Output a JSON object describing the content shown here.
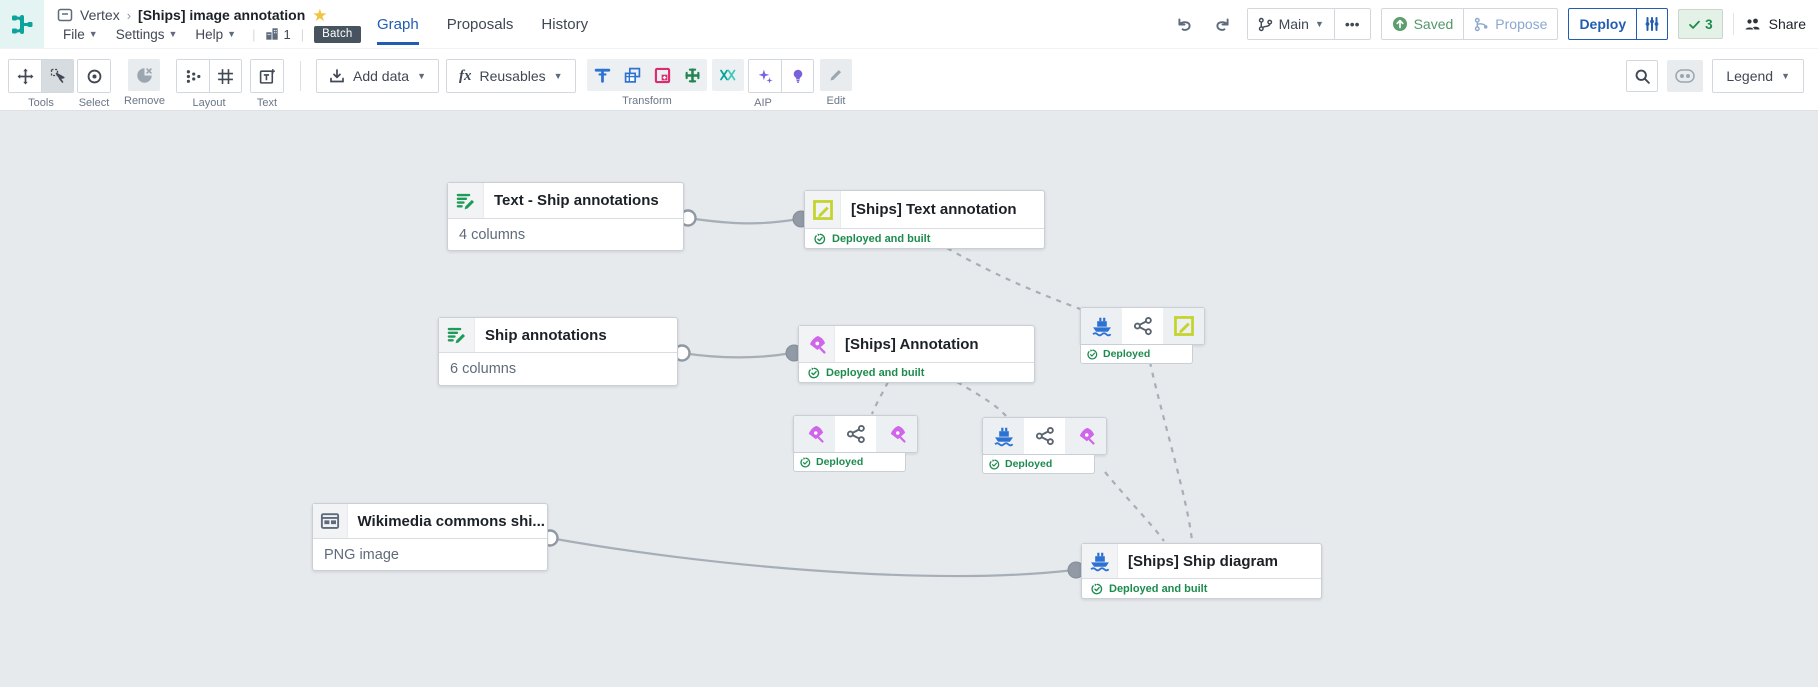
{
  "header": {
    "breadcrumb": {
      "app": "Vertex",
      "separator": "›",
      "title": "[Ships] image annotation"
    },
    "menu": {
      "file": "File",
      "settings": "Settings",
      "help": "Help"
    },
    "resource_count": "1",
    "batch_badge": "Batch",
    "tabs": [
      {
        "label": "Graph",
        "active": true
      },
      {
        "label": "Proposals",
        "active": false
      },
      {
        "label": "History",
        "active": false
      }
    ],
    "actions": {
      "branch_label": "Main",
      "more_label": "•••",
      "saved_label": "Saved",
      "propose_label": "Propose",
      "deploy_label": "Deploy",
      "checks_count": "3",
      "share_label": "Share"
    }
  },
  "toolbar": {
    "labels": {
      "tools": "Tools",
      "select": "Select",
      "remove": "Remove",
      "layout": "Layout",
      "text": "Text",
      "transform": "Transform",
      "aip": "AIP",
      "edit": "Edit"
    },
    "add_data_label": "Add data",
    "reusables_label": "Reusables",
    "legend_label": "Legend"
  },
  "canvas": {
    "nodes": [
      {
        "type": "dataset",
        "icon": "dataset-edit-icon",
        "title": "Text - Ship annotations",
        "subtitle": "4 columns"
      },
      {
        "type": "output",
        "icon": "annotation-square-icon",
        "title": "[Ships] Text annotation",
        "status": "Deployed and built"
      },
      {
        "type": "dataset",
        "icon": "dataset-edit-icon",
        "title": "Ship annotations",
        "subtitle": "6 columns"
      },
      {
        "type": "output",
        "icon": "pen-icon",
        "title": "[Ships] Annotation",
        "status": "Deployed and built"
      },
      {
        "type": "mini",
        "icons": [
          "ship-icon",
          "share-icon",
          "annotation-square-icon"
        ],
        "status": "Deployed"
      },
      {
        "type": "mini",
        "icons": [
          "pen-icon",
          "share-icon",
          "pen-icon"
        ],
        "status": "Deployed"
      },
      {
        "type": "mini",
        "icons": [
          "ship-icon",
          "share-icon",
          "pen-icon"
        ],
        "status": "Deployed"
      },
      {
        "type": "dataset",
        "icon": "media-icon",
        "title": "Wikimedia commons shi...",
        "subtitle": "PNG image"
      },
      {
        "type": "output",
        "icon": "ship-icon",
        "title": "[Ships] Ship diagram",
        "status": "Deployed and built"
      }
    ]
  },
  "colors": {
    "accent_blue": "#215DB0",
    "status_green": "#1C8C4D",
    "logo_teal": "#0BA39B",
    "lime": "#C4D32E",
    "pen_purple": "#CF66EA",
    "ship_blue": "#2D72D2",
    "pivot_red": "#DB2C6F",
    "aggregate_green": "#238551",
    "canvas_bg": "#E7EAED"
  }
}
